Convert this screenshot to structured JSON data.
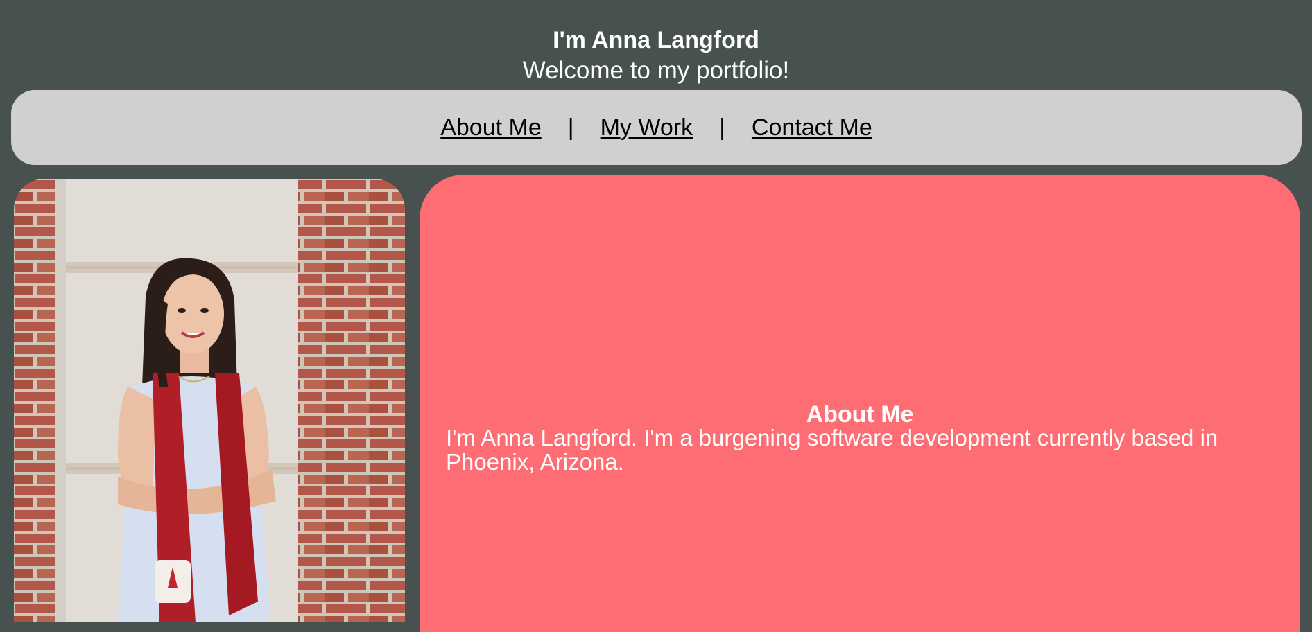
{
  "header": {
    "title": "I'm Anna Langford",
    "subtitle": "Welcome to my portfolio!"
  },
  "nav": {
    "items": [
      {
        "label": "About Me"
      },
      {
        "label": "My Work"
      },
      {
        "label": "Contact Me"
      }
    ],
    "separator": "|"
  },
  "photo": {
    "icon": "portrait-photo"
  },
  "about": {
    "heading": "About Me",
    "text": "I'm Anna Langford. I'm a burgening software development currently based in Phoenix, Arizona."
  },
  "colors": {
    "background": "#475150",
    "nav_background": "#d0d0d0",
    "card_accent": "#ff6d74",
    "text_light": "#ffffff"
  }
}
